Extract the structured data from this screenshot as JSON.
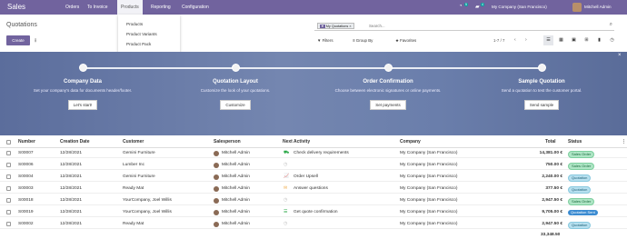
{
  "topbar": {
    "app": "Sales",
    "menus": [
      "Orders",
      "To Invoice",
      "Products",
      "Reporting",
      "Configuration"
    ],
    "msg_count": "5",
    "chat_count": "4",
    "company": "My Company (San Francisco)",
    "user": "Mitchell Admin"
  },
  "products_menu": [
    "Products",
    "Product Variants",
    "Product Pack"
  ],
  "page_title": "Quotations",
  "create_label": "Create",
  "search": {
    "facet_tag": "My Quotations",
    "facet_close": "×",
    "placeholder": "Search..."
  },
  "controls": {
    "filters": "Filters",
    "group_by": "Group By",
    "favorites": "Favorites"
  },
  "pager": "1-7 / 7",
  "onboarding": [
    {
      "title": "Company Data",
      "desc": "Set your company's data for documents header/footer.",
      "button": "Let's start!"
    },
    {
      "title": "Quotation Layout",
      "desc": "Customize the look of your quotations.",
      "button": "Customize"
    },
    {
      "title": "Order Confirmation",
      "desc": "Choose between electronic signatures or online payments.",
      "button": "Set payments"
    },
    {
      "title": "Sample Quotation",
      "desc": "Send a quotation to test the customer portal.",
      "button": "Send sample"
    }
  ],
  "columns": [
    "Number",
    "Creation Date",
    "Customer",
    "Salesperson",
    "Next Activity",
    "Company",
    "Total",
    "Status"
  ],
  "rows": [
    {
      "number": "S00007",
      "date": "12/28/2021",
      "customer": "Gemini Furniture",
      "salesperson": "Mitchell Admin",
      "activity": "Check delivery requirements",
      "activity_icon": "truck",
      "company": "My Company (San Francisco)",
      "total": "14,381.00 €",
      "status": "Sales Order",
      "status_type": "so"
    },
    {
      "number": "S00006",
      "date": "12/28/2021",
      "customer": "Lumber Inc",
      "salesperson": "Mitchell Admin",
      "activity": "",
      "activity_icon": "clock",
      "company": "My Company (San Francisco)",
      "total": "750.00 €",
      "status": "Sales Order",
      "status_type": "so"
    },
    {
      "number": "S00004",
      "date": "12/28/2021",
      "customer": "Gemini Furniture",
      "salesperson": "Mitchell Admin",
      "activity": "Order Upsell",
      "activity_icon": "chart",
      "company": "My Company (San Francisco)",
      "total": "2,240.00 €",
      "status": "Quotation",
      "status_type": "q"
    },
    {
      "number": "S00003",
      "date": "12/28/2021",
      "customer": "Ready Mat",
      "salesperson": "Mitchell Admin",
      "activity": "Answer questions",
      "activity_icon": "mail",
      "company": "My Company (San Francisco)",
      "total": "377.50 €",
      "status": "Quotation",
      "status_type": "q"
    },
    {
      "number": "S00018",
      "date": "12/28/2021",
      "customer": "YourCompany, Joel Willis",
      "salesperson": "Mitchell Admin",
      "activity": "",
      "activity_icon": "clock",
      "company": "My Company (San Francisco)",
      "total": "2,947.50 €",
      "status": "Sales Order",
      "status_type": "so"
    },
    {
      "number": "S00019",
      "date": "12/28/2021",
      "customer": "YourCompany, Joel Willis",
      "salesperson": "Mitchell Admin",
      "activity": "Get quote confirmation",
      "activity_icon": "list",
      "company": "My Company (San Francisco)",
      "total": "9,705.00 €",
      "status": "Quotation Sent",
      "status_type": "qs"
    },
    {
      "number": "S00002",
      "date": "12/28/2021",
      "customer": "Ready Mat",
      "salesperson": "Mitchell Admin",
      "activity": "",
      "activity_icon": "clock",
      "company": "My Company (San Francisco)",
      "total": "2,947.50 €",
      "status": "Quotation",
      "status_type": "q"
    }
  ],
  "grand_total": "33,348.50",
  "colors": {
    "brand": "#71639e",
    "sales_order": "#aee5c5",
    "quotation": "#b7e0ef",
    "quotation_sent": "#3b8bd1"
  }
}
